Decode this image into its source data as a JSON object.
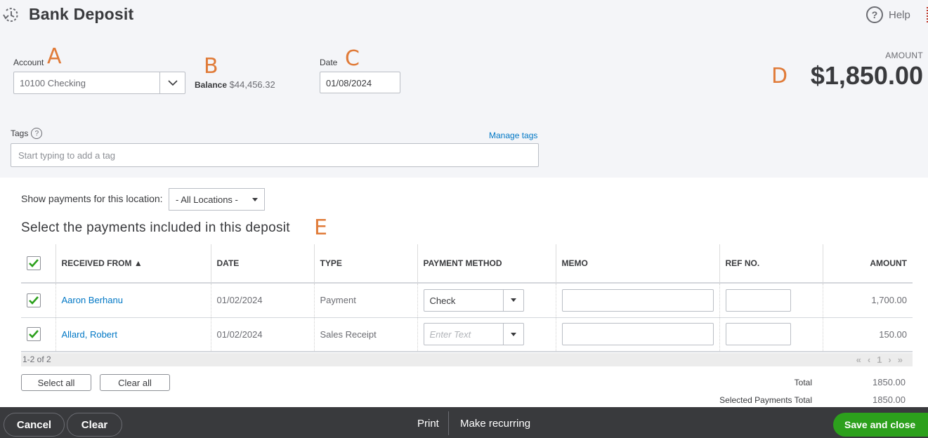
{
  "header": {
    "title": "Bank Deposit",
    "help_label": "Help"
  },
  "annotations": {
    "a": "A",
    "b": "B",
    "c": "C",
    "d": "D",
    "e": "E"
  },
  "account": {
    "label": "Account",
    "value": "10100 Checking",
    "balance_label": "Balance",
    "balance_value": "$44,456.32"
  },
  "date": {
    "label": "Date",
    "value": "01/08/2024"
  },
  "amount": {
    "label": "AMOUNT",
    "value": "$1,850.00"
  },
  "tags": {
    "label": "Tags",
    "help_glyph": "?",
    "manage_label": "Manage tags",
    "placeholder": "Start typing to add a tag"
  },
  "location": {
    "label": "Show payments for this location:",
    "selected": "- All Locations -"
  },
  "section_title": "Select the payments included in this deposit",
  "table": {
    "columns": [
      "RECEIVED FROM ▲",
      "DATE",
      "TYPE",
      "PAYMENT METHOD",
      "MEMO",
      "REF NO.",
      "AMOUNT"
    ],
    "header_checked": true,
    "rows": [
      {
        "checked": true,
        "received_from": "Aaron Berhanu",
        "date": "01/02/2024",
        "type": "Payment",
        "payment_method": "Check",
        "payment_method_placeholder": "",
        "memo": "",
        "ref_no": "",
        "amount": "1,700.00"
      },
      {
        "checked": true,
        "received_from": "Allard, Robert",
        "date": "01/02/2024",
        "type": "Sales Receipt",
        "payment_method": "",
        "payment_method_placeholder": "Enter Text",
        "memo": "",
        "ref_no": "",
        "amount": "150.00"
      }
    ],
    "pager_text": "1-2 of 2",
    "pager": {
      "first": "«",
      "prev": "‹",
      "page": "1",
      "next": "›",
      "last": "»"
    }
  },
  "actions": {
    "select_all": "Select all",
    "clear_all": "Clear all"
  },
  "totals": {
    "total_label": "Total",
    "total_value": "1850.00",
    "selected_label": "Selected Payments Total",
    "selected_value": "1850.00"
  },
  "footer": {
    "cancel": "Cancel",
    "clear": "Clear",
    "print": "Print",
    "make_recurring": "Make recurring",
    "save_and_close": "Save and close"
  },
  "colors": {
    "accent_green": "#2ca01c",
    "link_blue": "#0077c5",
    "annotation_orange": "#e07b39",
    "footer_bg": "#393a3d"
  }
}
